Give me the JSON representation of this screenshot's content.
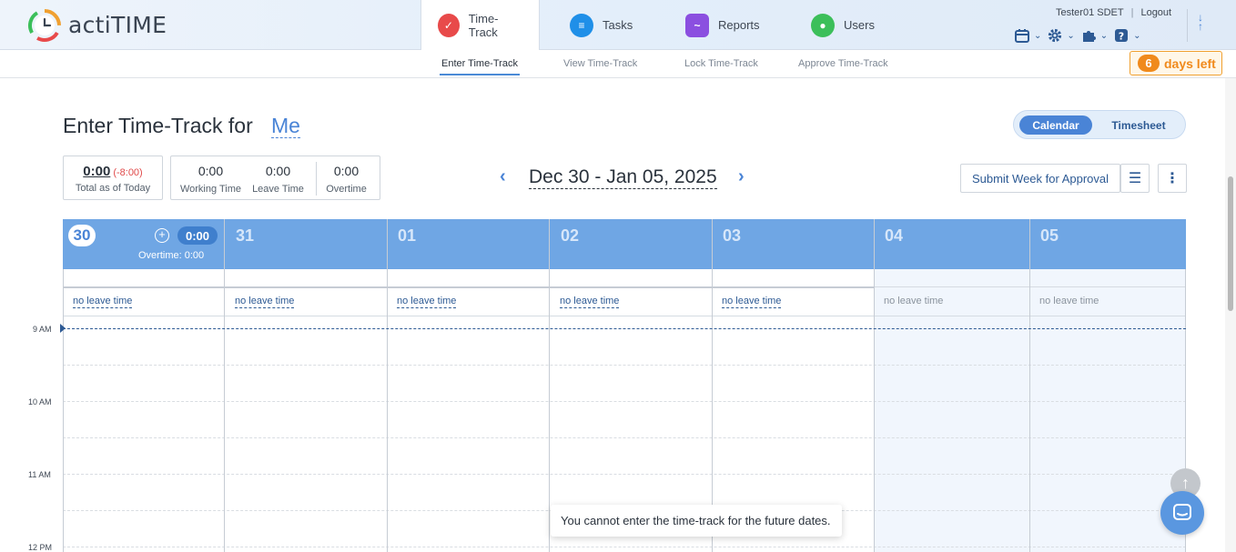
{
  "app": {
    "name": "actiTIME"
  },
  "nav": {
    "tabs": [
      {
        "label": "Time-Track",
        "icon": "time-track-icon",
        "color": "#e84a4a"
      },
      {
        "label": "Tasks",
        "icon": "tasks-icon",
        "color": "#1f8fe8"
      },
      {
        "label": "Reports",
        "icon": "reports-icon",
        "color": "#8b4fe0"
      },
      {
        "label": "Users",
        "icon": "users-icon",
        "color": "#3cbf5a"
      }
    ]
  },
  "user": {
    "name": "Tester01 SDET",
    "separator": "|",
    "logout": "Logout"
  },
  "subnav": {
    "items": [
      "Enter Time-Track",
      "View Time-Track",
      "Lock Time-Track",
      "Approve Time-Track"
    ]
  },
  "trial": {
    "days": "6",
    "text": "days left"
  },
  "page": {
    "title": "Enter Time-Track for",
    "user_link": "Me"
  },
  "view_toggle": {
    "calendar": "Calendar",
    "timesheet": "Timesheet"
  },
  "summary": {
    "total_value": "0:00",
    "total_diff": "(-8:00)",
    "total_label": "Total as of Today",
    "working_value": "0:00",
    "working_label": "Working Time",
    "leave_value": "0:00",
    "leave_label": "Leave Time",
    "overtime_value": "0:00",
    "overtime_label": "Overtime"
  },
  "week": {
    "range": "Dec 30 - Jan 05, 2025",
    "prev": "‹",
    "next": "›"
  },
  "actions": {
    "submit": "Submit Week for Approval"
  },
  "calendar": {
    "days": [
      {
        "num": "30",
        "today": true,
        "total": "0:00",
        "overtime": "Overtime:  0:00",
        "leave": "no leave time",
        "future": false
      },
      {
        "num": "31",
        "leave": "no leave time",
        "future": false
      },
      {
        "num": "01",
        "leave": "no leave time",
        "future": false
      },
      {
        "num": "02",
        "leave": "no leave time",
        "future": false
      },
      {
        "num": "03",
        "leave": "no leave time",
        "future": false
      },
      {
        "num": "04",
        "leave": "no leave time",
        "future": true
      },
      {
        "num": "05",
        "leave": "no leave time",
        "future": true
      }
    ],
    "hours": [
      "9 AM",
      "10 AM",
      "11 AM",
      "12 PM"
    ]
  },
  "toast": {
    "message": "You cannot enter the time-track for the future dates."
  }
}
